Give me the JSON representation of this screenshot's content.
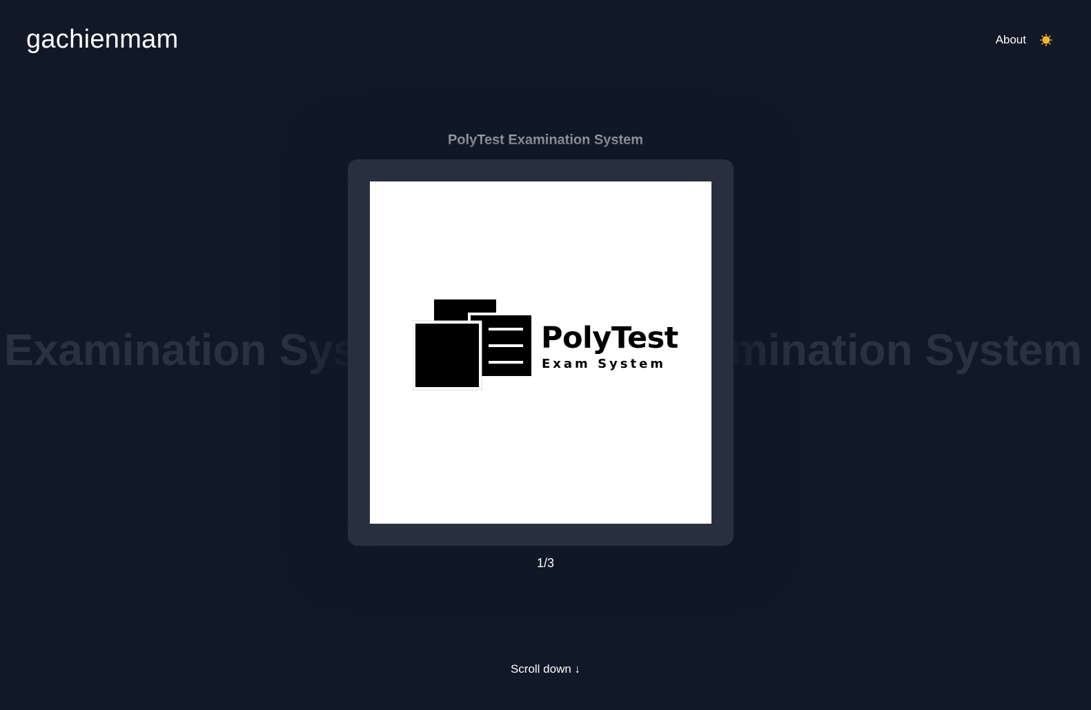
{
  "header": {
    "brand": "gachienmam",
    "nav_about": "About",
    "theme_icon": "sun-icon",
    "sun_color": "#f5b82e"
  },
  "background_text": {
    "left": "Examination Syst",
    "right": "mination System"
  },
  "project": {
    "title": "PolyTest Examination System",
    "slide": {
      "logo_name": "PolyTest",
      "logo_tagline": "Exam System",
      "logo_icon": "documents-icon"
    },
    "counter": "1/3"
  },
  "scroll_hint": "Scroll down ↓",
  "colors": {
    "background": "#111827",
    "frame": "#283040",
    "faded_text": "#2a3140"
  }
}
